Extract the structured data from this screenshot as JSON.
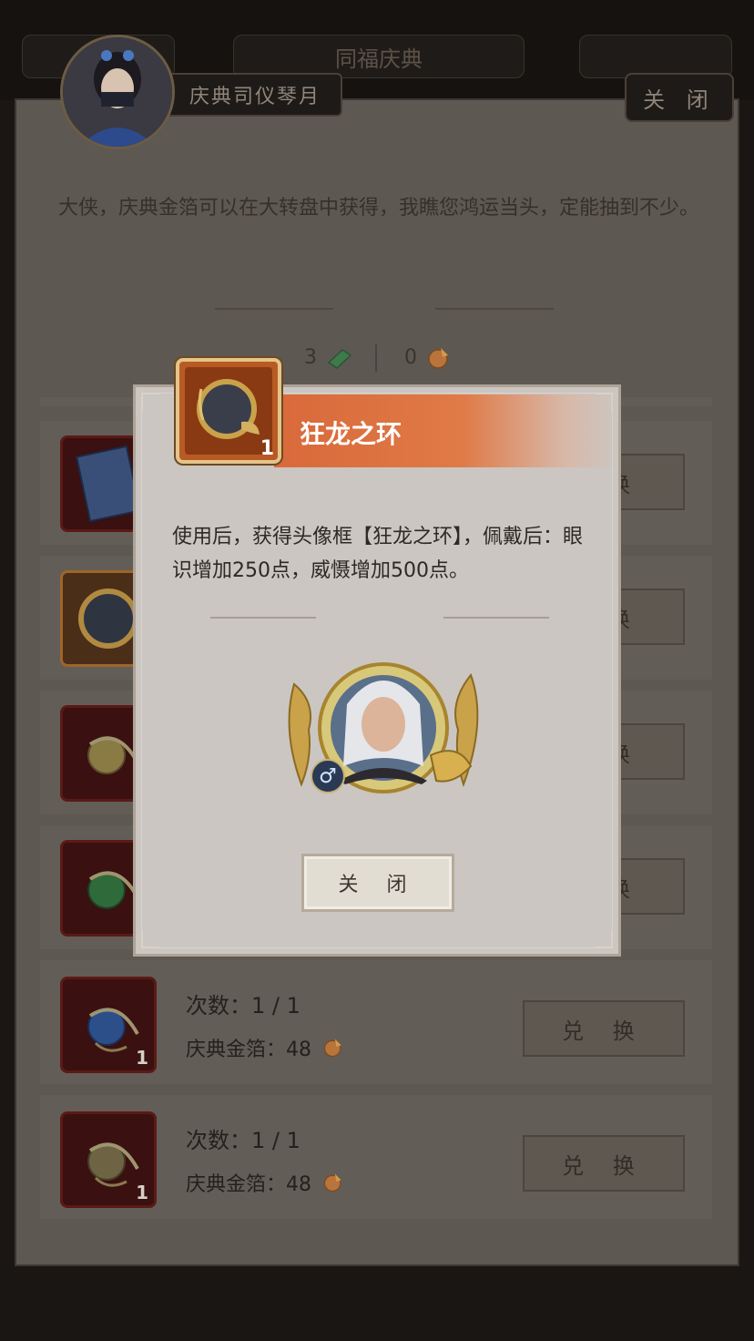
{
  "top_bar": {
    "center_tab": "同福庆典"
  },
  "npc": {
    "name": "庆典司仪琴月"
  },
  "top_close_label": "关 闭",
  "intro_text": "大侠，庆典金箔可以在大转盘中获得，我瞧您鸿运当头，定能抽到不少。",
  "currency": {
    "item_a_count": "3",
    "item_b_count": "0"
  },
  "rows": [
    {
      "icon": "book-icon",
      "count": "",
      "times": "",
      "cost": "",
      "button": "换"
    },
    {
      "icon": "ring-frame-icon",
      "count": "",
      "times": "",
      "cost": "",
      "button": "换"
    },
    {
      "icon": "gold-orb-icon",
      "count": "",
      "times": "",
      "cost": "",
      "button": "换"
    },
    {
      "icon": "green-orb-icon",
      "count": "",
      "times": "",
      "cost": "",
      "button": "换"
    },
    {
      "icon": "blue-orb-icon",
      "count": "1",
      "times": "次数：1 / 1",
      "cost": "庆典金箔：48",
      "button": "兑 换"
    },
    {
      "icon": "bronze-orb-icon",
      "count": "1",
      "times": "次数：1 / 1",
      "cost": "庆典金箔：48",
      "button": "兑 换"
    }
  ],
  "dialog": {
    "title": "狂龙之环",
    "item_count": "1",
    "description": "使用后，获得头像框【狂龙之环】，佩戴后：眼识增加250点，威慑增加500点。",
    "close_label": "关 闭",
    "gender_symbol": "♂"
  },
  "colors": {
    "header_orange": "#d9693a",
    "gold": "#c9a24a"
  }
}
